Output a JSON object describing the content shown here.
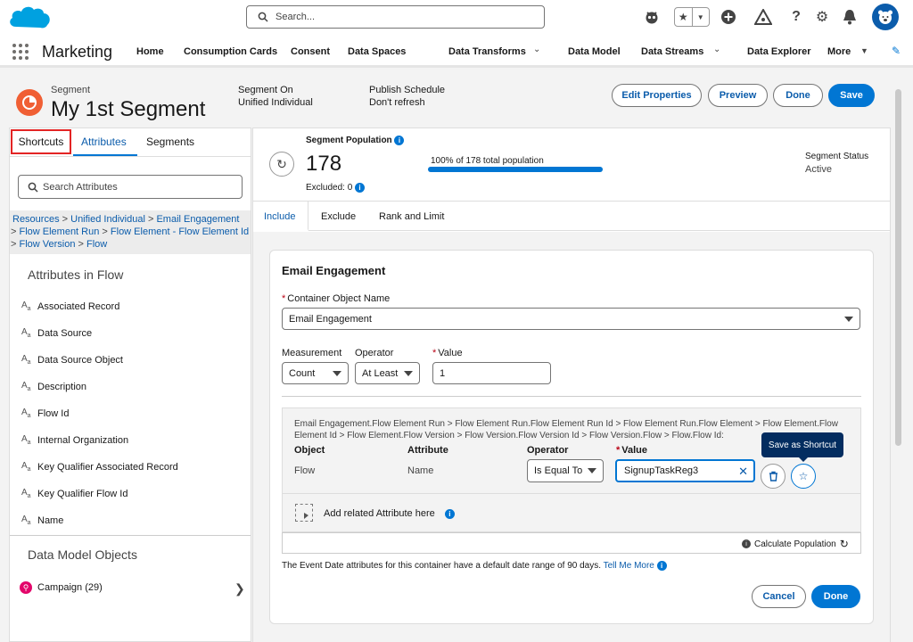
{
  "topbar": {
    "search_placeholder": "Search...",
    "icons": [
      "salesforce-cloud-icon",
      "search-icon",
      "einstein-icon",
      "favorites-star-icon",
      "favorites-dropdown-icon",
      "global-add-icon",
      "trailhead-icon",
      "help-icon",
      "setup-gear-icon",
      "notifications-bell-icon",
      "user-avatar-icon"
    ]
  },
  "nav": {
    "app_name": "Marketing",
    "items": [
      "Home",
      "Consumption Cards",
      "Consent",
      "Data Spaces",
      "Data Transforms",
      "Data Model",
      "Data Streams",
      "Data Explorer",
      "More"
    ]
  },
  "header": {
    "object_type": "Segment",
    "title": "My 1st Segment",
    "segment_on_label": "Segment On",
    "segment_on_value": "Unified Individual",
    "publish_label": "Publish Schedule",
    "publish_value": "Don't refresh",
    "buttons": {
      "edit": "Edit Properties",
      "preview": "Preview",
      "done": "Done",
      "save": "Save"
    }
  },
  "left": {
    "tabs": [
      "Shortcuts",
      "Attributes",
      "Segments"
    ],
    "active_tab": "Attributes",
    "search_placeholder": "Search Attributes",
    "breadcrumb": [
      "Resources",
      "Unified Individual",
      "Email Engagement",
      "Flow Element Run",
      "Flow Element - Flow Element Id",
      "Flow Version",
      "Flow"
    ],
    "attributes_title": "Attributes in Flow",
    "attributes": [
      "Associated Record",
      "Data Source",
      "Data Source Object",
      "Description",
      "Flow Id",
      "Internal Organization",
      "Key Qualifier Associated Record",
      "Key Qualifier Flow Id",
      "Name"
    ],
    "dmo_title": "Data Model Objects",
    "dmo_items": [
      {
        "label": "Campaign (29)"
      }
    ]
  },
  "population": {
    "label": "Segment Population",
    "value": "178",
    "excluded": "Excluded: 0",
    "percent_text": "100% of 178 total population",
    "percent": 1.0,
    "status_label": "Segment Status",
    "status_value": "Active"
  },
  "rule_tabs": [
    "Include",
    "Exclude",
    "Rank and Limit"
  ],
  "rule": {
    "title": "Email Engagement",
    "container_label": "Container Object Name",
    "container_value": "Email Engagement",
    "measurement_label": "Measurement",
    "measurement_value": "Count",
    "operator_label": "Operator",
    "operator_value": "At Least",
    "value_label": "Value",
    "value_value": "1",
    "filter_path": "Email Engagement.Flow Element Run > Flow Element Run.Flow Element Run Id > Flow Element Run.Flow Element > Flow Element.Flow Element Id > Flow Element.Flow Version > Flow Version.Flow Version Id > Flow Version.Flow > Flow.Flow Id:",
    "cols": {
      "object": "Object",
      "attribute": "Attribute",
      "operator": "Operator",
      "value": "Value"
    },
    "row": {
      "object": "Flow",
      "attribute": "Name",
      "operator": "Is Equal To",
      "value": "SignupTaskReg3"
    },
    "tooltip": "Save as Shortcut",
    "add_related": "Add related Attribute here",
    "calc_population": "Calculate Population",
    "date_note": "The Event Date attributes for this container have a default date range of 90 days.",
    "tell_me_more": "Tell Me More",
    "cancel": "Cancel",
    "done": "Done"
  },
  "colors": {
    "brand": "#0176d3",
    "highlight_box": "#e32424",
    "segment_icon": "#f05f34",
    "campaign_icon": "#e3066a"
  }
}
